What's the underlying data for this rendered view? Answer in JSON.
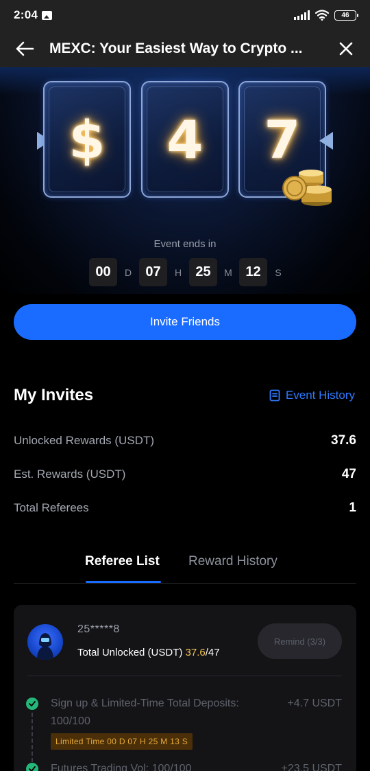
{
  "status_bar": {
    "time": "2:04",
    "battery": "46"
  },
  "header": {
    "title": "MEXC: Your Easiest Way to Crypto ..."
  },
  "hero": {
    "slots": [
      "$",
      "4",
      "7"
    ]
  },
  "event": {
    "label": "Event ends in",
    "countdown": [
      {
        "value": "00",
        "unit": "D"
      },
      {
        "value": "07",
        "unit": "H"
      },
      {
        "value": "25",
        "unit": "M"
      },
      {
        "value": "12",
        "unit": "S"
      }
    ]
  },
  "invite_button": "Invite Friends",
  "my_invites": {
    "title": "My Invites",
    "history_link": "Event History",
    "stats": [
      {
        "label": "Unlocked Rewards (USDT)",
        "value": "37.6"
      },
      {
        "label": "Est. Rewards (USDT)",
        "value": "47"
      },
      {
        "label": "Total Referees",
        "value": "1"
      }
    ]
  },
  "tabs": {
    "active": "Referee List",
    "inactive": "Reward History"
  },
  "referee": {
    "id": "25*****8",
    "total_unlocked_prefix": "Total Unlocked (USDT) ",
    "unlocked": "37.6",
    "total": "/47",
    "remind": "Remind (3/3)",
    "tasks": [
      {
        "label_line1": "Sign up & Limited-Time Total Deposits:",
        "label_line2": "100/100",
        "reward": "+4.7 USDT",
        "tag": "Limited Time 00 D 07 H 25 M 13 S"
      },
      {
        "label_line1": "Futures Trading Vol: 100/100",
        "reward": "+23.5 USDT"
      }
    ]
  },
  "colors": {
    "accent": "#1a6bff",
    "gold": "#f5c451",
    "success": "#25b77a"
  }
}
